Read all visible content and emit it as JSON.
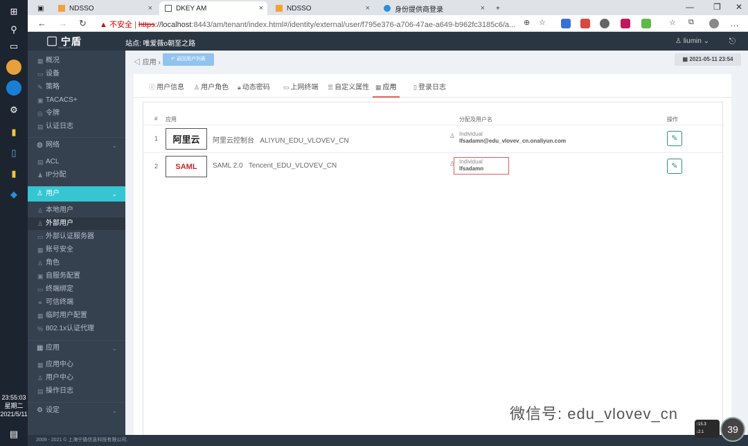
{
  "browser": {
    "tabs": [
      {
        "title": "NDSSO"
      },
      {
        "title": "DKEY AM"
      },
      {
        "title": "NDSSO"
      },
      {
        "title": "身份提供商登录"
      }
    ],
    "security_warning": "不安全",
    "url_scheme": "https",
    "url_rest": "://localhost",
    "url_path": ":8443/am/tenant/index.html#/identity/external/user/f795e376-a706-47ae-a649-b962fc3185c6/a..."
  },
  "taskbar": {
    "time": "23:55:03",
    "weekday": "星期二",
    "date": "2021/5/11"
  },
  "header": {
    "logo": "宁盾",
    "logo_sub": "NINGDUN",
    "site": "站点: 唯爱薇o朝至之路",
    "user": "liumin"
  },
  "sidebar": {
    "items_top": [
      {
        "label": "概况"
      },
      {
        "label": "设备"
      },
      {
        "label": "策略"
      },
      {
        "label": "TACACS+"
      },
      {
        "label": "令牌"
      },
      {
        "label": "认证日志"
      }
    ],
    "group_network": "网络",
    "items_network": [
      {
        "label": "ACL"
      },
      {
        "label": "IP分配"
      }
    ],
    "group_user": "用户",
    "items_user": [
      {
        "label": "本地用户"
      },
      {
        "label": "外部用户"
      },
      {
        "label": "外部认证服务器"
      },
      {
        "label": "账号安全"
      },
      {
        "label": "角色"
      },
      {
        "label": "自服务配置"
      },
      {
        "label": "终端绑定"
      },
      {
        "label": "可信终端"
      },
      {
        "label": "临时用户配置"
      },
      {
        "label": "802.1x认证代理"
      }
    ],
    "group_app": "应用",
    "items_app": [
      {
        "label": "应用中心"
      },
      {
        "label": "用户中心"
      },
      {
        "label": "操作日志"
      }
    ],
    "group_settings": "设定"
  },
  "content": {
    "breadcrumb": "应用",
    "back_button": "返回用户列表",
    "date": "2021-05-11 23:54",
    "tabs": [
      {
        "label": "用户信息"
      },
      {
        "label": "用户角色"
      },
      {
        "label": "动态密码"
      },
      {
        "label": "上网终端"
      },
      {
        "label": "自定义属性"
      },
      {
        "label": "应用"
      },
      {
        "label": "登录日志"
      }
    ],
    "table": {
      "headers": [
        "#",
        "应用",
        "分配及用户名",
        "操作"
      ],
      "rows": [
        {
          "num": "1",
          "logo": "阿里云",
          "name": "阿里云控制台",
          "code": "ALIYUN_EDU_VLOVEV_CN",
          "type": "Individual",
          "username": "lfsadamn@edu_vlovev_cn.onaliyun.com"
        },
        {
          "num": "2",
          "logo": "SAML",
          "name": "SAML 2.0",
          "code": "Tencent_EDU_VLOVEV_CN",
          "type": "Individual",
          "username": "lfsadamn"
        }
      ]
    }
  },
  "footer": "2009 - 2021 © 上海宁盾信息科技有限公司.",
  "watermark": "微信号: edu_vlovev_cn",
  "netmeter": {
    "up": "15.3",
    "down": "2.1"
  },
  "cpu": "39"
}
